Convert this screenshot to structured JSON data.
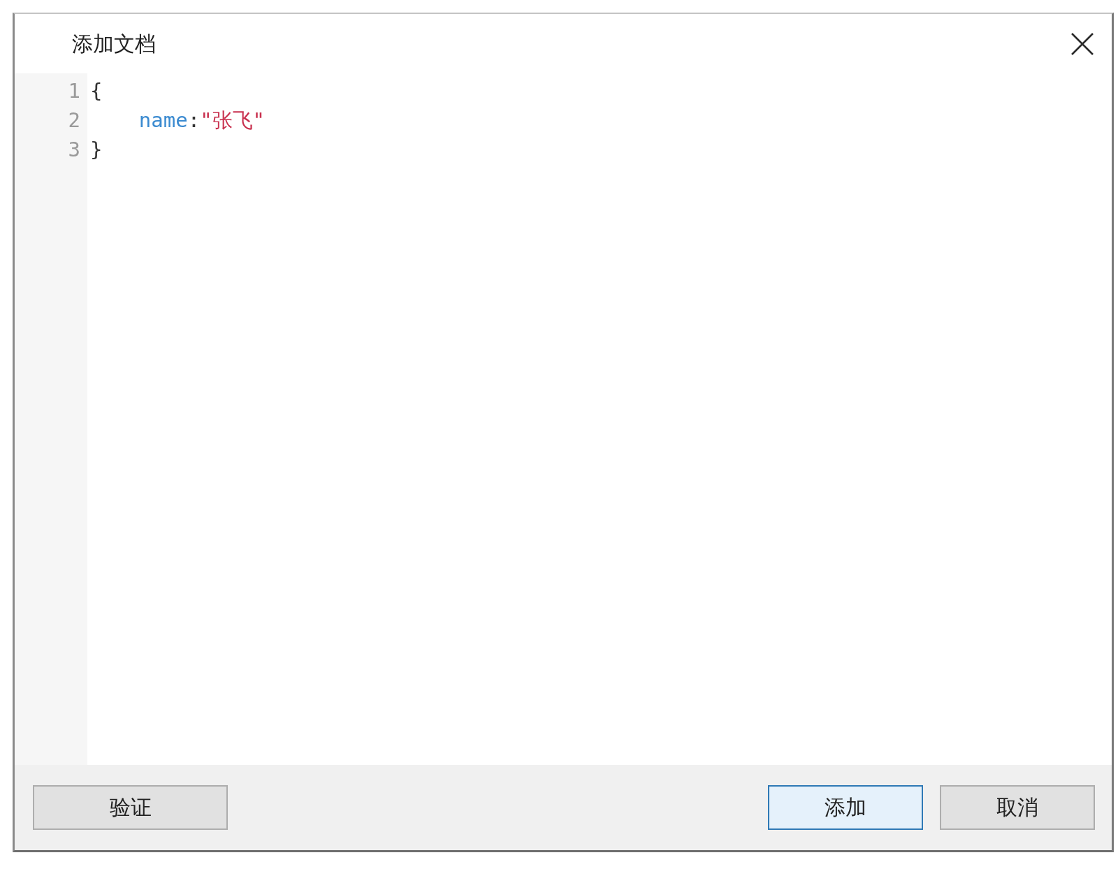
{
  "window": {
    "title": "添加文档"
  },
  "editor": {
    "lines": [
      {
        "number": "1",
        "tokens": [
          {
            "kind": "punct",
            "text": "{"
          }
        ]
      },
      {
        "number": "2",
        "tokens": [
          {
            "kind": "key",
            "text": "    name"
          },
          {
            "kind": "punct",
            "text": ":"
          },
          {
            "kind": "string",
            "text": "\"张飞\""
          }
        ]
      },
      {
        "number": "3",
        "tokens": [
          {
            "kind": "punct",
            "text": "}"
          }
        ]
      }
    ]
  },
  "footer": {
    "left_buttons": [
      {
        "label": "验证",
        "focused": false
      }
    ],
    "right_buttons": [
      {
        "label": "添加",
        "focused": true
      },
      {
        "label": "取消",
        "focused": false
      }
    ]
  }
}
